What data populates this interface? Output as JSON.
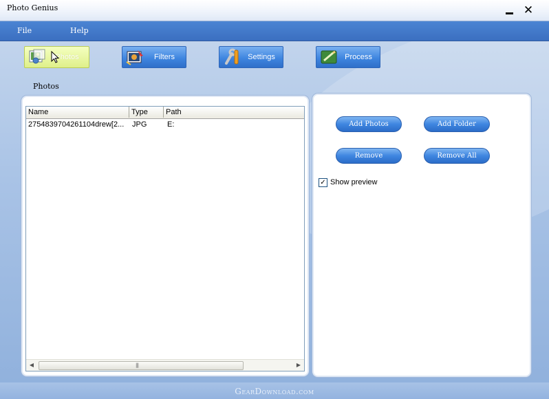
{
  "window": {
    "title": "Photo Genius"
  },
  "menu": {
    "items": [
      {
        "label": "File"
      },
      {
        "label": "Help"
      }
    ]
  },
  "toolbar": {
    "buttons": [
      {
        "label": "Photos",
        "icon": "photos-icon",
        "active": true
      },
      {
        "label": "Filters",
        "icon": "filters-icon",
        "active": false
      },
      {
        "label": "Settings",
        "icon": "settings-icon",
        "active": false
      },
      {
        "label": "Process",
        "icon": "process-icon",
        "active": false
      }
    ]
  },
  "section": {
    "label": "Photos"
  },
  "list": {
    "columns": [
      "Name",
      "Type",
      "Path"
    ],
    "rows": [
      {
        "name": "2754839704261104drew[2...",
        "type": "JPG",
        "path": "E:"
      }
    ],
    "scroll_grip": "|||"
  },
  "actions": {
    "add_photos": "Add Photos",
    "add_folder": "Add Folder",
    "remove": "Remove",
    "remove_all": "Remove All"
  },
  "options": {
    "show_preview_label": "Show preview",
    "show_preview_checked": true
  },
  "watermark": {
    "text": "GearDownload.com"
  },
  "colors": {
    "menu_bar": "#3b6fc0",
    "active_tab": "#dff08a",
    "button_blue": "#3f86e0"
  }
}
